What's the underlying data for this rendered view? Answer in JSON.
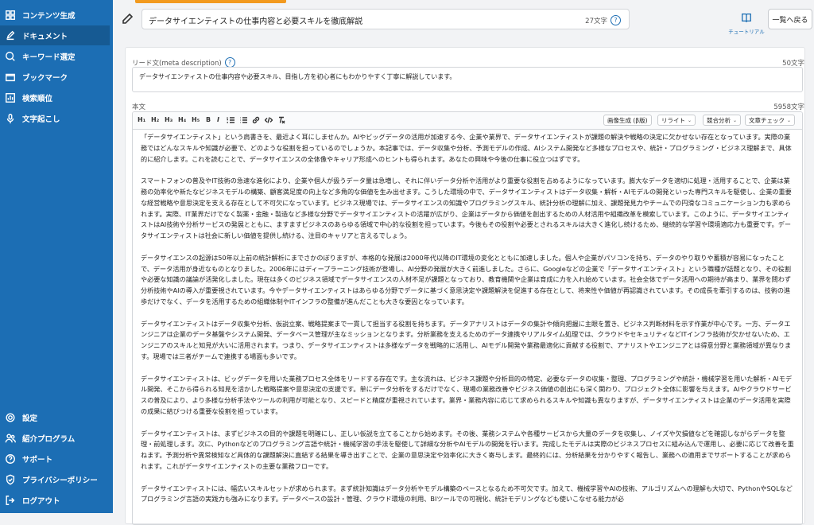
{
  "sidebar": {
    "top_items": [
      {
        "label": "コンテンツ生成",
        "icon": "grid-icon"
      },
      {
        "label": "ドキュメント",
        "icon": "edit-icon"
      },
      {
        "label": "キーワード選定",
        "icon": "search-icon"
      },
      {
        "label": "ブックマーク",
        "icon": "bookmark-icon"
      },
      {
        "label": "検索順位",
        "icon": "chart-icon"
      },
      {
        "label": "文字起こし",
        "icon": "microphone-icon"
      }
    ],
    "bottom_items": [
      {
        "label": "設定",
        "icon": "gear-icon"
      },
      {
        "label": "紹介プログラム",
        "icon": "users-icon"
      },
      {
        "label": "サポート",
        "icon": "help-icon"
      },
      {
        "label": "プライバシーポリシー",
        "icon": "shield-icon"
      },
      {
        "label": "ログアウト",
        "icon": "logout-icon"
      }
    ]
  },
  "header": {
    "title": "データサイエンティストの仕事内容と必要スキルを徹底解説",
    "title_count": "27文字",
    "tutorial_label": "チュートリアル",
    "back_button": "一覧へ戻る"
  },
  "meta": {
    "label": "リード文(meta description)",
    "count": "50文字",
    "text": "データサイエンティストの仕事内容や必要スキル、目指し方を初心者にもわかりやすく丁寧に解説しています。"
  },
  "body": {
    "label": "本文",
    "count": "5958文字",
    "toolbar": {
      "h1": "H₁",
      "h2": "H₂",
      "h3": "H₃",
      "h4": "H₄",
      "h5": "H₅",
      "bold": "B",
      "italic": "I",
      "image_gen": "画像生成 (β版)",
      "rewrite": "リライト",
      "competitor": "競合分析",
      "check": "文章チェック"
    },
    "paragraphs": [
      "「データサイエンティスト」という肩書きを、最近よく耳にしませんか。AIやビッグデータの活用が加速する今、企業や業界で、データサイエンティストが課題の解決や戦略の決定に欠かせない存在となっています。実際の業務ではどんなスキルや知識が必要で、どのような役割を担っているのでしょうか。本記事では、データ収集や分析、予測モデルの作成、AIシステム開発など多様なプロセスや、統計・プログラミング・ビジネス理解まで、具体的に紹介します。これを読むことで、データサイエンスの全体像やキャリア形成へのヒントも得られます。あなたの興味や今後の仕事に役立つはずです。",
      "スマートフォンの普及やIT技術の急速な進化により、企業や個人が扱うデータ量は急増し、それに伴いデータ分析や活用がより重要な役割を占めるようになっています。膨大なデータを適切に処理・活用することで、企業は業務の効率化や新たなビジネスモデルの構築、顧客満足度の向上など多角的な価値を生み出せます。こうした環境の中で、データサイエンティストはデータ収集・解析・AIモデルの開発といった専門スキルを駆使し、企業の重要な経営戦略や意思決定を支える存在として不可欠になっています。ビジネス現場では、データサイエンスの知識やプログラミングスキル、統計分析の理解に加え、課題発見力やチームでの円滑なコミュニケーション力も求められます。実際、IT業界だけでなく製薬・金融・製造など多様な分野でデータサイエンティストの活躍が広がり、企業はデータから価値を創出するための人材活用や組織改革を模索しています。このように、データサイエンティストはAI技術や分析サービスの発展とともに、ますますビジネスのあらゆる領域で中心的な役割を担っています。今後もその役割や必要とされるスキルは大きく進化し続けるため、継続的な学習や環境適応力も重要です。データサイエンティストは社会に新しい価値を提供し続ける、注目のキャリアと言えるでしょう。",
      "データサイエンスの起源は50年以上前の統計解析にまでさかのぼりますが、本格的な発展は2000年代以降のIT環境の変化とともに加速しました。個人や企業がパソコンを持ち、データのやり取りや蓄積が容易になったことで、データ活用が身近なものとなりました。2006年にはディープラーニング技術が登場し、AI分野の発展が大きく前進しました。さらに、Googleなどの企業で「データサイエンティスト」という職種が話題となり、その役割や必要な知識の議論が活発化しました。現在は多くのビジネス領域でデータサイエンスの人材不足が課題となっており、教育機関や企業は育成に力を入れ始めています。社会全体でデータ活用への期待が高まり、業界を問わず分析技術やAIの導入が重要視されています。今やデータサイエンティストはあらゆる分野でデータに基づく意思決定や課題解決を促進する存在として、将来性や価値が再認識されています。その成長を牽引するのは、技術の進歩だけでなく、データを活用するための組織体制やITインフラの整備が進んだことも大きな要因となっています。",
      "データサイエンティストはデータ収集や分析、仮説立案、戦略提案まで一貫して担当する役割を持ちます。データアナリストはデータの集計や傾向把握に主眼を置き、ビジネス判断材料を示す作業が中心です。一方、データエンジニアは企業のデータ基盤やシステム開発、データベース管理が主なミッションとなります。分析業務を支えるためのデータ連携やリアルタイム処理では、クラウドやセキュリティなどITインフラ技術が欠かせないため、エンジニアのスキルと知見が大いに活用されます。つまり、データサイエンティストは多様なデータを戦略的に活用し、AIモデル開発や業務最適化に貢献する役割で、アナリストやエンジニアとは得意分野と業務領域が異なります。現場では三者がチームで連携する場面も多いです。",
      "データサイエンティストは、ビッグデータを用いた業務プロセス全体をリードする存在です。主な流れは、ビジネス課題や分析目的の特定、必要なデータの収集・整理、プログラミングや統計・機械学習を用いた解析・AIモデル開発、そこから得られる知見を活かした戦略提案や意思決定の支援です。単にデータ分析をするだけでなく、現場の業務改善やビジネス価値の創出にも深く関わり、プロジェクト全体に影響を与えます。AIやクラウドサービスの普及により、より多様な分析手法やツールの利用が可能となり、スピードと精度が重視されています。業界・業務内容に応じて求められるスキルや知識も異なりますが、データサイエンティストは企業のデータ活用を実際の成果に結びつける重要な役割を担っています。",
      "データサイエンティストは、まずビジネスの目的や課題を明確にし、正しい仮説を立てることから始めます。その後、業務システムや各種サービスから大量のデータを収集し、ノイズや欠損値などを確認しながらデータを整理・前処理します。次に、Pythonなどのプログラミング言語や統計・機械学習の手法を駆使して詳細な分析やAIモデルの開発を行います。完成したモデルは実際のビジネスプロセスに組み込んで運用し、必要に応じて改善を重ねます。予測分析や異常検知など具体的な課題解決に直結する結果を導き出すことで、企業の意思決定や効率化に大きく寄与します。最終的には、分析結果を分かりやすく報告し、業務への適用までサポートすることが求められます。これがデータサイエンティストの主要な業務フローです。",
      "データサイエンティストには、幅広いスキルセットが求められます。まず統計知識はデータ分析やモデル構築のベースとなるため不可欠です。加えて、機械学習やAIの技術、アルゴリズムへの理解も大切で、PythonやSQLなどプログラミング言語の実践力も強みになります。データベースの設計・管理、クラウド環境の利用、BIツールでの可視化、統計モデリングなども使いこなせる能力が必"
    ]
  }
}
